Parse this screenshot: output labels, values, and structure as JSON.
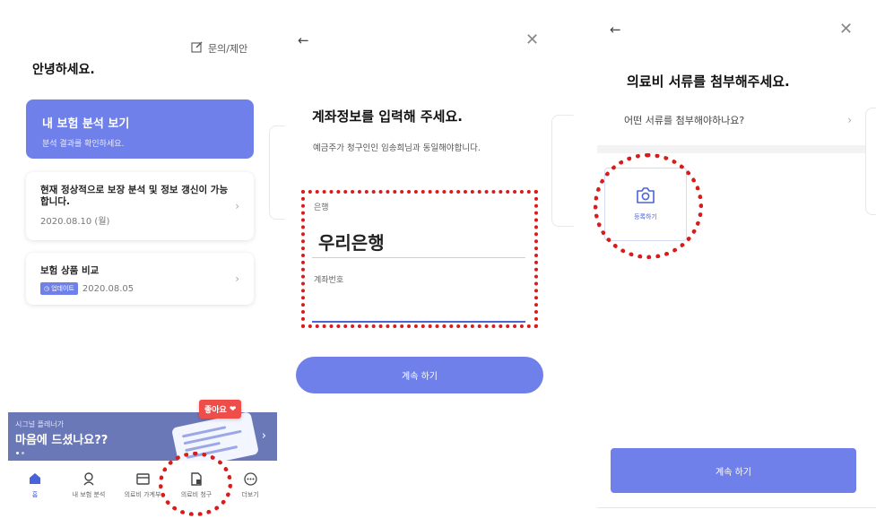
{
  "colors": {
    "accent": "#6f80ea",
    "active_tab": "#4a63d8",
    "highlight": "#d81c1c",
    "like_badge": "#ef4d4a",
    "banner": "#6b78b8"
  },
  "screen1": {
    "inquiry_label": "문의/제안",
    "inquiry_icon": "edit-icon",
    "greeting": "안녕하세요.",
    "main_card": {
      "title": "내 보험 분석 보기",
      "subtitle": "분석 결과를 확인하세요."
    },
    "card2": {
      "title": "현재 정상적으로 보장 분석 및 정보 갱신이 가능합니다.",
      "date": "2020.08.10 (월)"
    },
    "card3": {
      "title": "보험 상품 비교",
      "badge": "업데이트",
      "date": "2020.08.05"
    },
    "banner": {
      "small": "시그널 플레너가",
      "big": "마음에 드셨나요??"
    },
    "like_badge": "좋아요",
    "tabs": [
      {
        "label": "홈",
        "icon": "home-icon"
      },
      {
        "label": "내 보험 분석",
        "icon": "person-icon"
      },
      {
        "label": "의료비 가계부",
        "icon": "ledger-icon"
      },
      {
        "label": "의료비 청구",
        "icon": "claim-document-icon"
      },
      {
        "label": "더보기",
        "icon": "more-icon"
      }
    ]
  },
  "screen2": {
    "back_icon": "back-arrow-icon",
    "close_icon": "close-icon",
    "title": "계좌정보를 입력해 주세요.",
    "subtitle": "예금주가 청구인인 임송희님과 동일해야합니다.",
    "bank_label": "은행",
    "bank_value": "우리은행",
    "account_label": "계좌번호",
    "account_value": "",
    "button": "계속 하기"
  },
  "screen3": {
    "back_icon": "back-arrow-icon",
    "close_icon": "close-icon",
    "title": "의료비 서류를 첨부해주세요.",
    "question": "어떤 서류를 첨부해야하나요?",
    "upload_label": "등록하기",
    "upload_icon": "camera-icon",
    "button": "계속 하기"
  }
}
